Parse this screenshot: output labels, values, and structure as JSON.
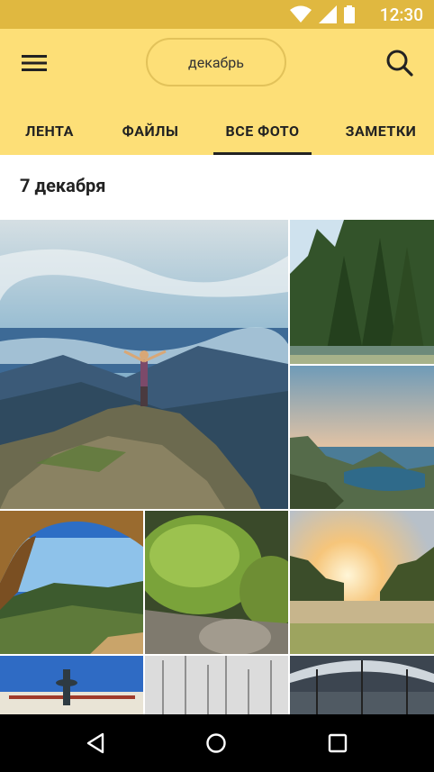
{
  "status_bar": {
    "time": "12:30",
    "icons": [
      "wifi-icon",
      "cellular-icon",
      "battery-icon"
    ]
  },
  "app_bar": {
    "date_selector": "декабрь",
    "tabs": [
      {
        "label": "ЛЕНТА",
        "active": false
      },
      {
        "label": "ФАЙЛЫ",
        "active": false
      },
      {
        "label": "ВСЕ ФОТО",
        "active": true
      },
      {
        "label": "ЗАМЕТКИ",
        "active": false
      }
    ]
  },
  "content": {
    "section_date": "7 декабря",
    "photos": [
      "mountain-summit-woman",
      "forest-lake",
      "sea-cliff-sunset",
      "rock-arch-view",
      "mossy-rocks",
      "sunset-lake",
      "fountain-city",
      "sailboat-masts",
      "station-hall"
    ]
  },
  "colors": {
    "appbar": "#fddf77",
    "statusbar": "#e0b840",
    "navbar": "#000000"
  },
  "nav_bar": {
    "buttons": [
      "back-icon",
      "home-icon",
      "recents-icon"
    ]
  }
}
